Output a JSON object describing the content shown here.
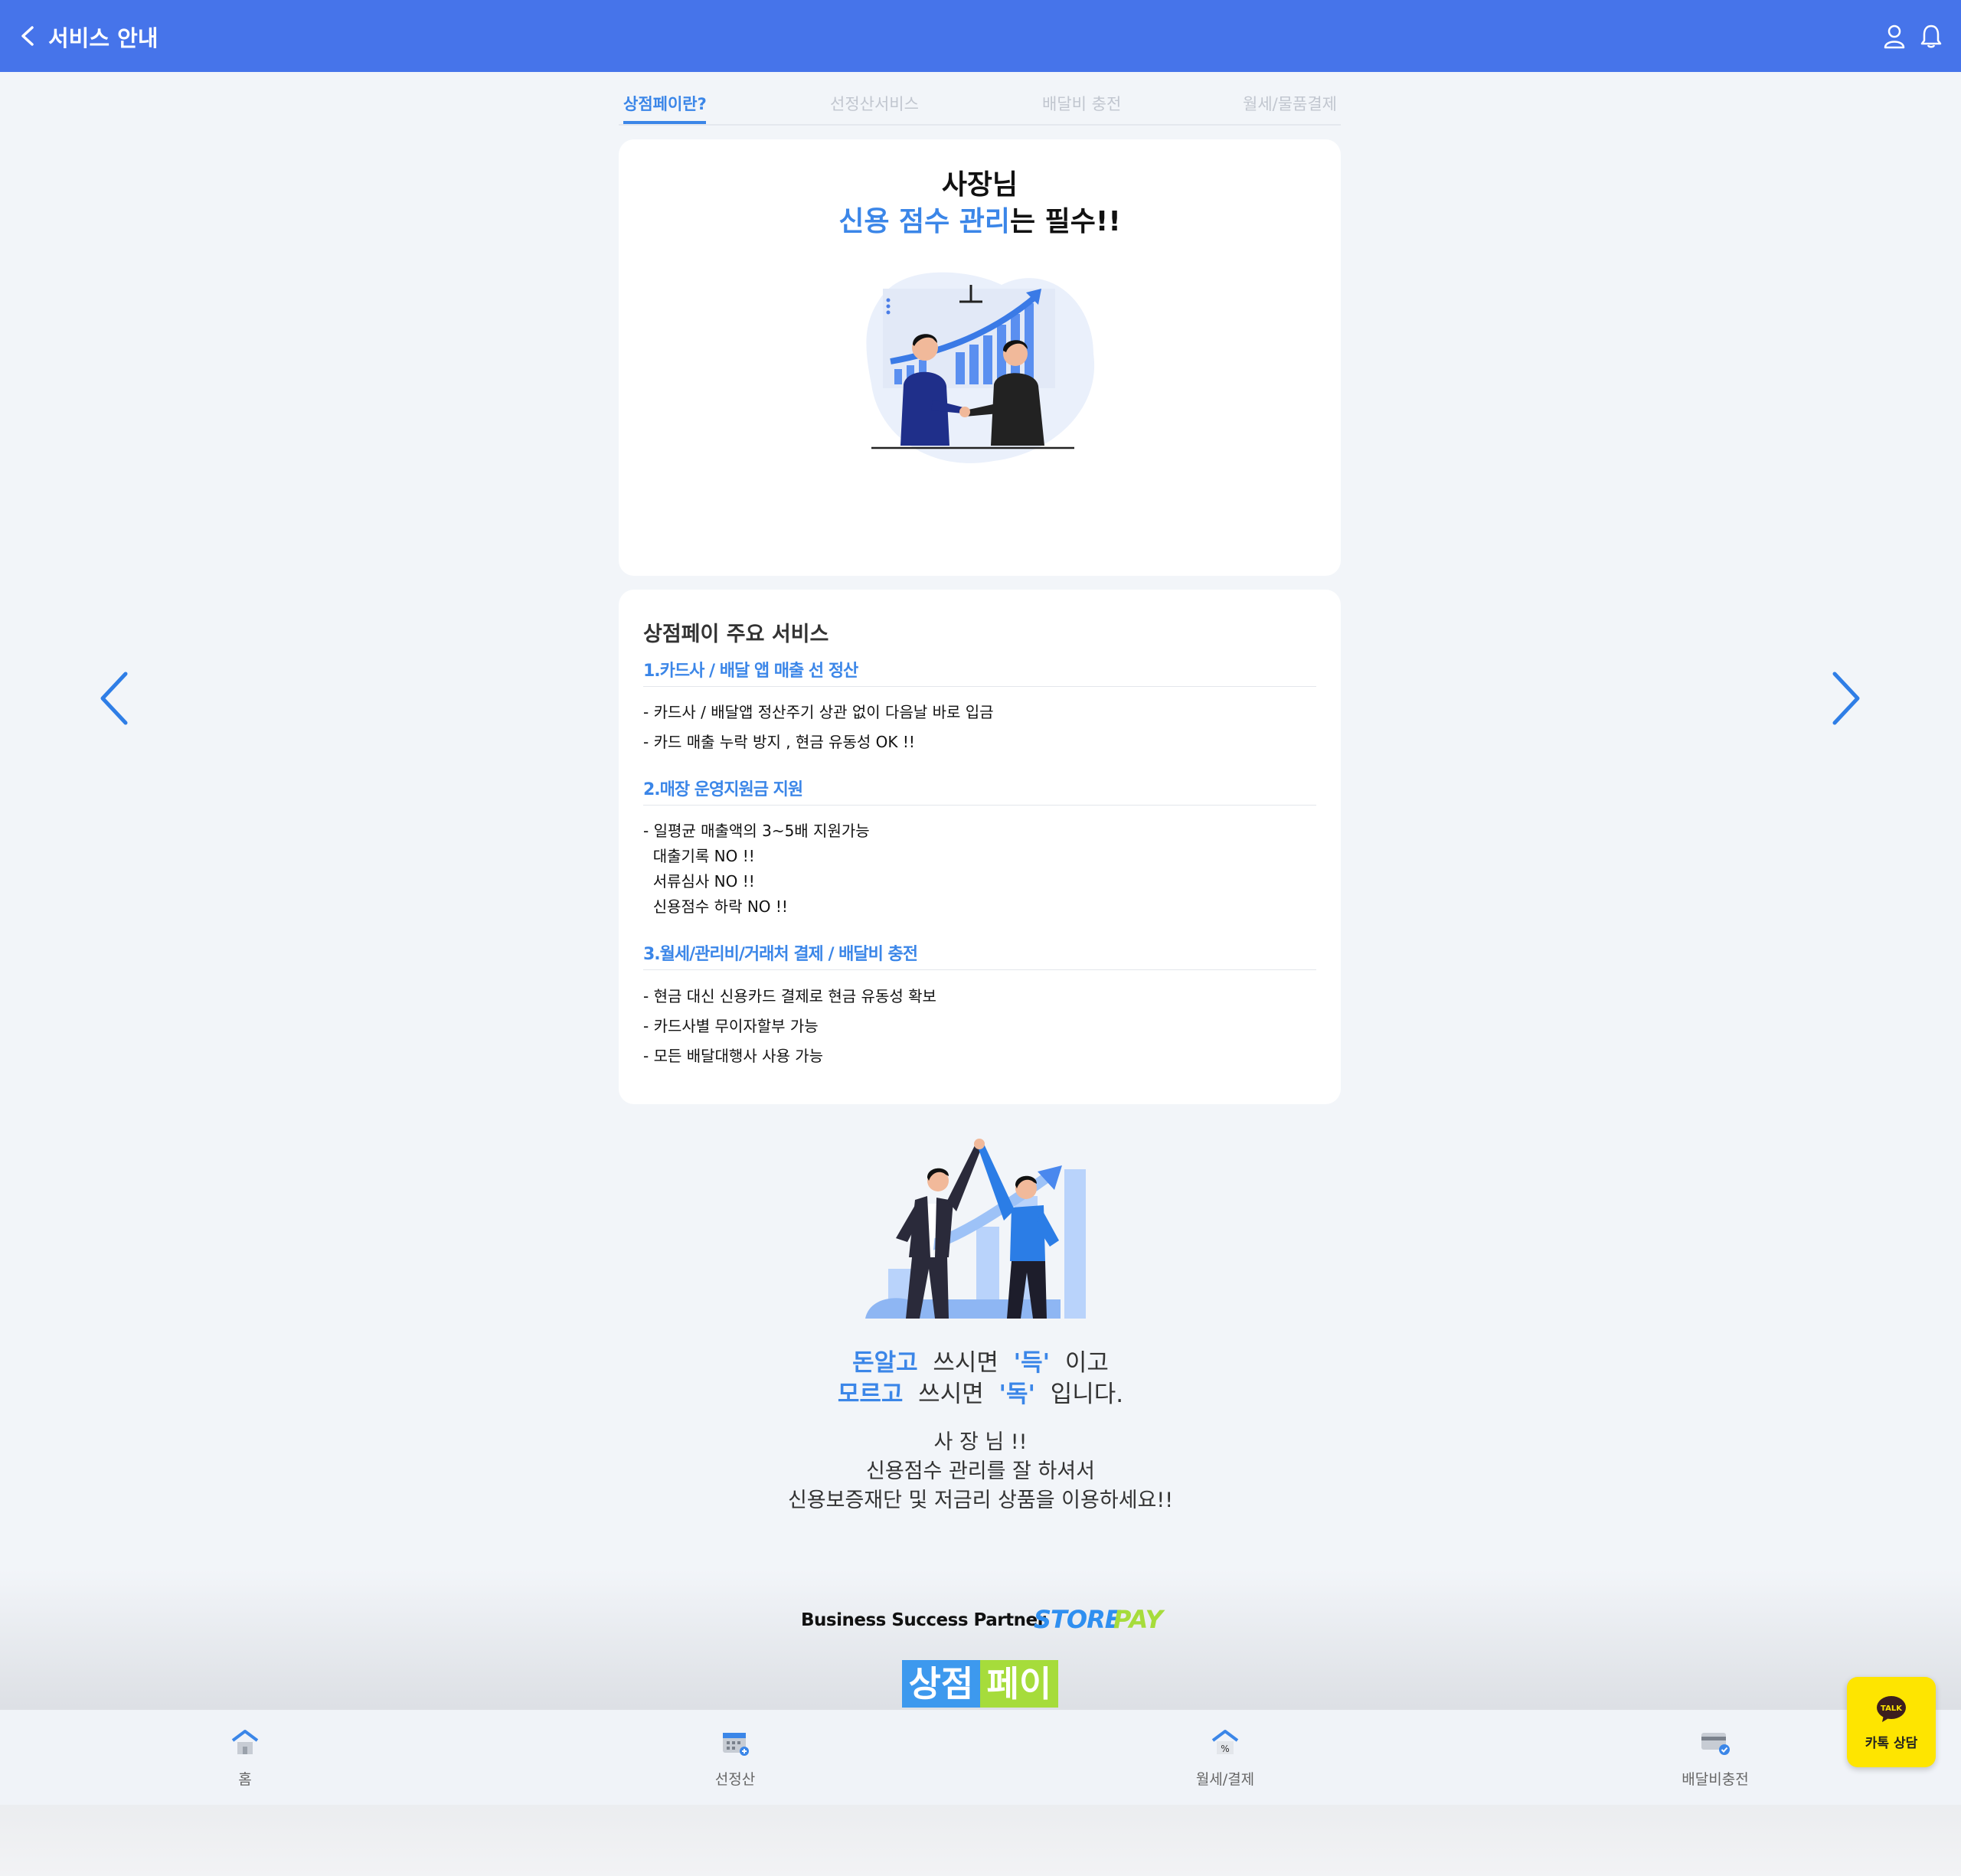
{
  "header": {
    "title": "서비스 안내",
    "back_icon": "chevron-left-icon",
    "user_icon": "user-icon",
    "bell_icon": "bell-icon",
    "bg_color": "#4674ea"
  },
  "tabs": [
    {
      "label": "상점페이란?",
      "active": true
    },
    {
      "label": "선정산서비스",
      "active": false
    },
    {
      "label": "배달비 충전",
      "active": false
    },
    {
      "label": "월세/물품결제",
      "active": false
    }
  ],
  "card1": {
    "line1": "사장님",
    "line2_highlight": "신용 점수 관리",
    "line2_rest": "는 필수!!"
  },
  "card2": {
    "title": "상점페이 주요 서비스",
    "sections": [
      {
        "heading": "1.카드사 / 배달 앱 매출 선 정산",
        "items": [
          "- 카드사 / 배달앱 정산주기 상관 없이 다음날 바로 입금",
          "- 카드 매출 누락 방지 , 현금 유동성 OK !!"
        ]
      },
      {
        "heading": "2.매장 운영지원금 지원",
        "items": [
          "- 일평균 매출액의 3~5배 지원가능",
          "  대출기록 NO !!",
          "  서류심사 NO !!",
          "  신용점수 하락 NO !!"
        ]
      },
      {
        "heading": "3.월세/관리비/거래처 결제 / 배달비 충전",
        "items": [
          "- 현금 대신 신용카드 결제로 현금 유동성 확보",
          "- 카드사별 무이자할부 가능",
          "- 모든 배달대행사 사용 가능"
        ]
      }
    ]
  },
  "slogan": {
    "l1_a": "돈알고",
    "l1_b": "쓰시면",
    "l1_c": "'득'",
    "l1_d": "이고",
    "l2_a": "모르고",
    "l2_b": "쓰시면",
    "l2_c": "'독'",
    "l2_d": "입니다."
  },
  "message": [
    "사 장 님 !!",
    "신용점수 관리를 잘 하셔서",
    "신용보증재단 및 저금리 상품을 이용하세요!!"
  ],
  "brand": {
    "tagline": "Business Success Partner",
    "store": "STORE",
    "pay": "PAY",
    "logo_left": "상점",
    "logo_right": "페이"
  },
  "bottom_nav": [
    {
      "label": "홈",
      "icon": "home-icon"
    },
    {
      "label": "선정산",
      "icon": "calendar-icon"
    },
    {
      "label": "월세/결제",
      "icon": "house-percent-icon"
    },
    {
      "label": "배달비충전",
      "icon": "card-check-icon"
    }
  ],
  "kakao": {
    "talk": "TALK",
    "label": "카톡 상담"
  },
  "colors": {
    "accent": "#3b86e8",
    "green": "#a6dc3b",
    "kakao": "#fee500"
  }
}
